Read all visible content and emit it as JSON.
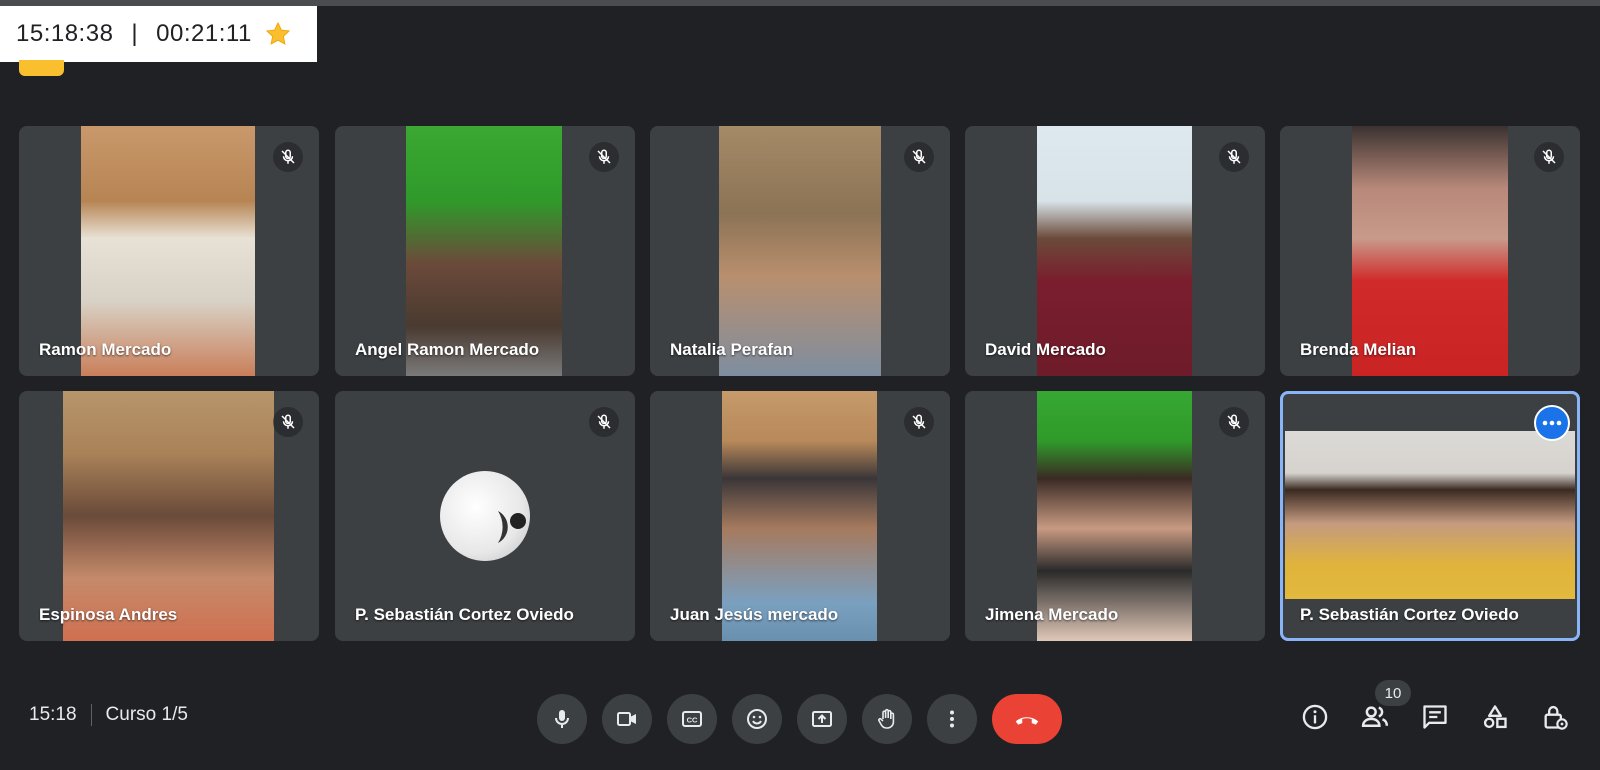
{
  "header": {
    "current_time": "15:18:38",
    "separator": "|",
    "elapsed": "00:21:11",
    "star_icon": "star-icon"
  },
  "participants": [
    {
      "name": "Ramon Mercado",
      "muted": true
    },
    {
      "name": "Angel Ramon Mercado",
      "muted": true
    },
    {
      "name": "Natalia Perafan",
      "muted": true
    },
    {
      "name": "David Mercado",
      "muted": true
    },
    {
      "name": "Brenda Melian",
      "muted": true
    },
    {
      "name": "Espinosa Andres",
      "muted": true
    },
    {
      "name": "P. Sebastián Cortez Oviedo",
      "muted": true
    },
    {
      "name": "Juan Jesús mercado",
      "muted": true
    },
    {
      "name": "Jimena Mercado",
      "muted": true
    },
    {
      "name": "P. Sebastián Cortez Oviedo",
      "muted": false,
      "active": true
    }
  ],
  "footer": {
    "time": "15:18",
    "meeting_name": "Curso 1/5",
    "participant_count": "10"
  },
  "controls": [
    "microphone-icon",
    "camera-icon",
    "captions-icon",
    "emoji-icon",
    "present-icon",
    "raise-hand-icon",
    "more-options-icon",
    "end-call-icon"
  ],
  "right_controls": [
    "info-icon",
    "people-icon",
    "chat-icon",
    "activities-icon",
    "host-controls-icon"
  ],
  "colors": {
    "background": "#202124",
    "tile": "#3c4043",
    "end_call": "#ea4335",
    "active_border": "#8ab4f8",
    "accent": "#1a73e8",
    "star": "#f9bf2f"
  }
}
